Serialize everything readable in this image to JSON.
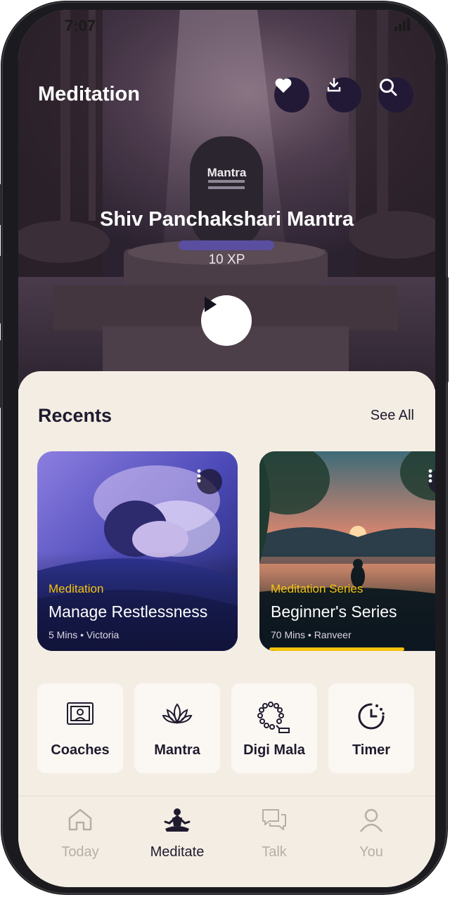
{
  "status_bar": {
    "time": "7:07"
  },
  "header": {
    "title": "Meditation",
    "icons": [
      "heart-icon",
      "download-icon",
      "search-icon"
    ]
  },
  "hero": {
    "tag": "Mantra",
    "title": "Shiv Panchakshari Mantra",
    "xp": "10 XP"
  },
  "recents": {
    "title": "Recents",
    "see_all": "See All",
    "cards": [
      {
        "category": "Meditation",
        "title": "Manage Restlessness",
        "meta": "5 Mins • Victoria"
      },
      {
        "category": "Meditation Series",
        "title": "Beginner's Series",
        "meta": "70 Mins • Ranveer",
        "progress_percent": 60
      }
    ]
  },
  "tools": [
    {
      "label": "Coaches",
      "icon": "coaches-icon"
    },
    {
      "label": "Mantra",
      "icon": "lotus-icon"
    },
    {
      "label": "Digi Mala",
      "icon": "mala-beads-icon"
    },
    {
      "label": "Timer",
      "icon": "timer-icon"
    }
  ],
  "tabbar": {
    "items": [
      {
        "label": "Today",
        "icon": "home-icon"
      },
      {
        "label": "Meditate",
        "icon": "meditate-icon",
        "active": true
      },
      {
        "label": "Talk",
        "icon": "chat-icon"
      },
      {
        "label": "You",
        "icon": "profile-icon"
      }
    ]
  },
  "colors": {
    "accent_yellow": "#f4c20d",
    "dark_purple": "#221937",
    "sheet_bg": "#f3ede3"
  }
}
